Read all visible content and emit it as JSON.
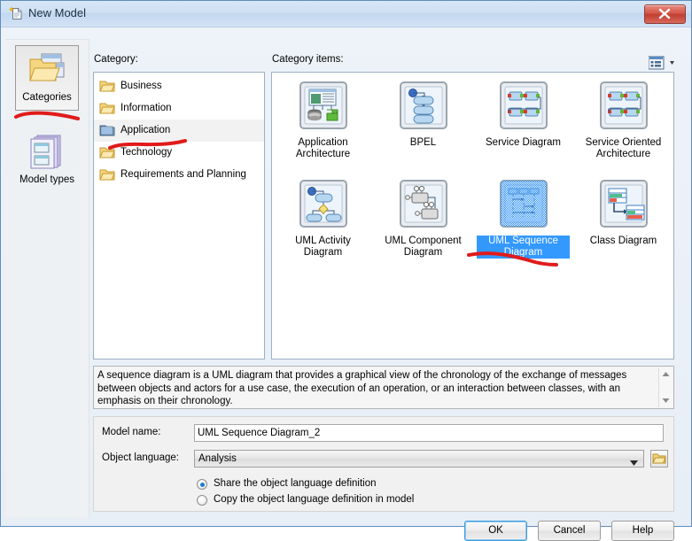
{
  "window": {
    "title": "New Model",
    "title_icon": "new-document-icon",
    "close_label": "x",
    "accent_color": "#3399ff",
    "titlebar_color": "#cfe0f4",
    "annotation_color": "#e01b1b"
  },
  "rail": {
    "items": [
      {
        "label": "Categories",
        "icon": "folder-windows-icon",
        "selected": true
      },
      {
        "label": "Model types",
        "icon": "stacked-pages-icon",
        "selected": false
      }
    ]
  },
  "category": {
    "heading": "Category:",
    "items": [
      {
        "label": "Business",
        "icon": "folder-icon",
        "selected": false
      },
      {
        "label": "Information",
        "icon": "folder-icon",
        "selected": false
      },
      {
        "label": "Application",
        "icon": "folder-open-icon",
        "selected": true
      },
      {
        "label": "Technology",
        "icon": "folder-icon",
        "selected": false
      },
      {
        "label": "Requirements and Planning",
        "icon": "folder-icon",
        "selected": false
      }
    ]
  },
  "items": {
    "heading": "Category items:",
    "view_mode_icon": "list-view-icon",
    "view_mode_caret": "chevron-down-icon",
    "tiles": [
      {
        "label": "Application Architecture",
        "icon": "application-architecture-icon",
        "selected": false
      },
      {
        "label": "BPEL",
        "icon": "bpel-icon",
        "selected": false
      },
      {
        "label": "Service Diagram",
        "icon": "service-diagram-icon",
        "selected": false
      },
      {
        "label": "Service Oriented Architecture",
        "icon": "service-oriented-architecture-icon",
        "selected": false
      },
      {
        "label": "UML Activity Diagram",
        "icon": "uml-activity-diagram-icon",
        "selected": false
      },
      {
        "label": "UML Component Diagram",
        "icon": "uml-component-diagram-icon",
        "selected": false
      },
      {
        "label": "UML Sequence Diagram",
        "icon": "uml-sequence-diagram-icon",
        "selected": true
      },
      {
        "label": "Class Diagram",
        "icon": "class-diagram-icon",
        "selected": false
      }
    ]
  },
  "description": {
    "text": "A sequence diagram is a UML diagram that provides a graphical view of the chronology of the exchange of messages between objects and actors for a use case, the execution of an operation, or an interaction between classes, with an emphasis on their chronology."
  },
  "form": {
    "model_name_label": "Model name:",
    "model_name_value": "UML Sequence Diagram_2",
    "object_language_label": "Object language:",
    "object_language_value": "Analysis",
    "browse_icon": "folder-browse-icon",
    "radio_share_label": "Share the object language definition",
    "radio_copy_label": "Copy the object language definition in model",
    "radio_selected": "share"
  },
  "buttons": {
    "ok": "OK",
    "cancel": "Cancel",
    "help": "Help"
  }
}
